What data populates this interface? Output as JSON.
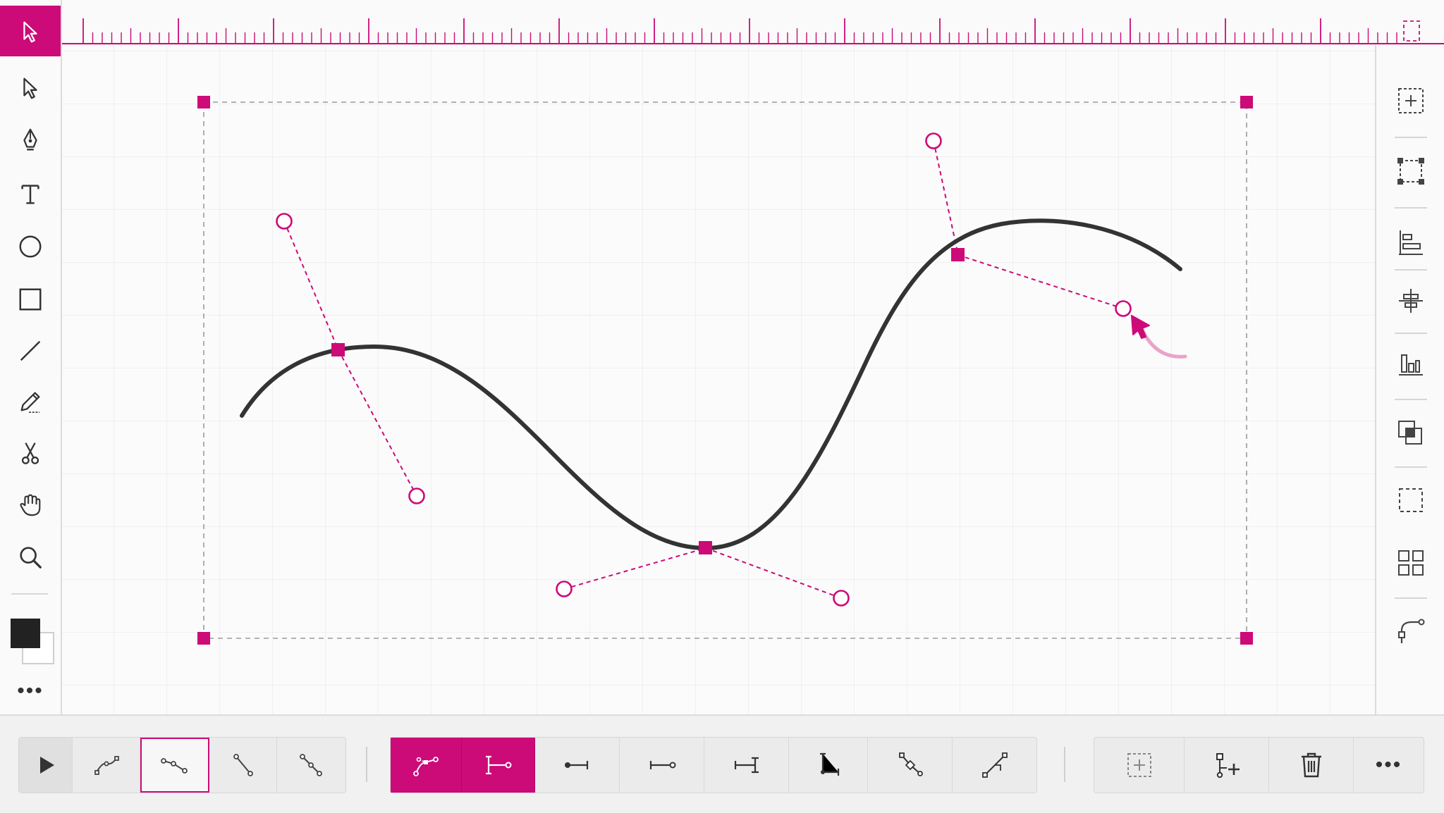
{
  "app": {
    "accent_color": "#cc0a78",
    "curve_color": "#333333"
  },
  "left_toolbar": {
    "tools": [
      {
        "name": "select-tool",
        "icon": "arrow-cursor-icon",
        "active": true
      },
      {
        "name": "direct-select-tool",
        "icon": "arrow-outline-icon",
        "active": false
      },
      {
        "name": "pen-tool",
        "icon": "pen-nib-icon",
        "active": false
      },
      {
        "name": "text-tool",
        "icon": "text-icon",
        "active": false
      },
      {
        "name": "ellipse-tool",
        "icon": "circle-icon",
        "active": false
      },
      {
        "name": "rectangle-tool",
        "icon": "square-icon",
        "active": false
      },
      {
        "name": "line-tool",
        "icon": "line-icon",
        "active": false
      },
      {
        "name": "pencil-tool",
        "icon": "pencil-icon",
        "active": false
      },
      {
        "name": "scissors-tool",
        "icon": "scissors-icon",
        "active": false
      },
      {
        "name": "hand-tool",
        "icon": "hand-icon",
        "active": false
      },
      {
        "name": "zoom-tool",
        "icon": "magnifier-icon",
        "active": false
      }
    ],
    "fill_color": "#222222",
    "stroke_color": "#ffffff",
    "more_label": "•••"
  },
  "right_panel": {
    "tools": [
      "add-frame-icon",
      "bounding-box-icon",
      "align-left-icon",
      "distribute-vertical-icon",
      "align-bottom-icon",
      "overlap-icon",
      "dashed-frame-icon",
      "grid-icon",
      "bezier-corner-icon"
    ]
  },
  "bottom_bar": {
    "group1": [
      "play-icon",
      "node-smooth-icon",
      "node-segment-icon",
      "node-line-icon",
      "node-break-icon"
    ],
    "group2": [
      "smooth-node-icon",
      "handle-line-icon",
      "line-end-dot-icon",
      "line-start-dot-icon",
      "line-bar-icon",
      "corner-join-icon",
      "node-convert-icon",
      "node-edit-icon"
    ],
    "group3": [
      "add-frame-icon",
      "add-node-icon",
      "trash-icon",
      "more-icon"
    ],
    "more_label": "•••"
  }
}
